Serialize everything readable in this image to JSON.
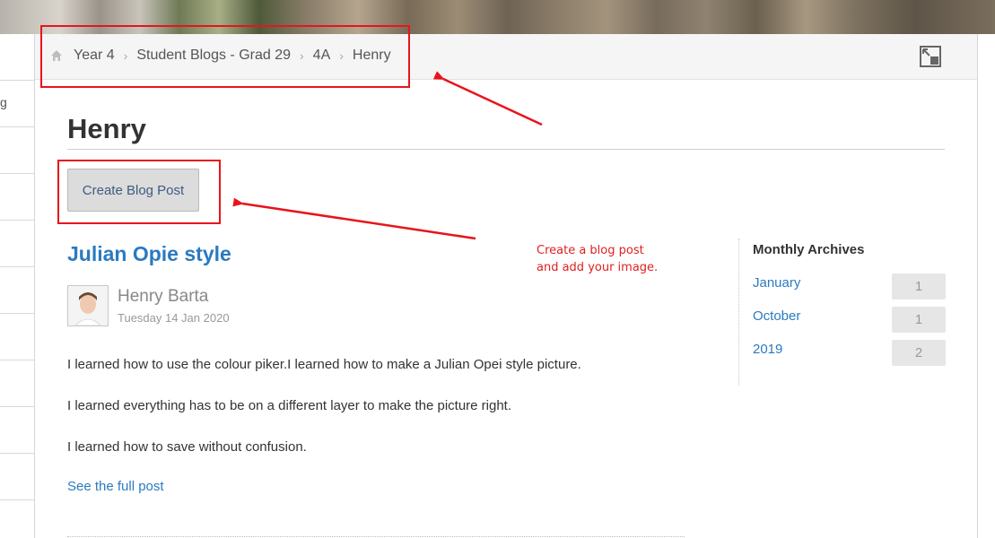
{
  "breadcrumb": {
    "items": [
      "Year 4",
      "Student Blogs - Grad 29",
      "4A",
      "Henry"
    ]
  },
  "leftnav": {
    "labels": [
      "g"
    ]
  },
  "page": {
    "title": "Henry"
  },
  "toolbar": {
    "create_label": "Create Blog Post"
  },
  "post": {
    "title": "Julian Opie style",
    "author": "Henry Barta",
    "date": "Tuesday 14 Jan 2020",
    "paragraphs": [
      "I learned how to use the colour piker.I learned how to make a Julian Opei style picture.",
      "I learned everything has to be on a different layer to make the picture right.",
      "I learned how to save without confusion."
    ],
    "full_link": "See the full post"
  },
  "archives": {
    "heading": "Monthly Archives",
    "items": [
      {
        "label": "January",
        "count": "1"
      },
      {
        "label": "October",
        "count": "1"
      },
      {
        "label": "2019",
        "count": "2"
      }
    ]
  },
  "annotation": {
    "note": "Create a blog post\nand add your image.",
    "color": "#e8141c"
  },
  "icons": {
    "home": "home-icon",
    "separator": "chevron-right-icon",
    "expand": "expand-icon"
  }
}
